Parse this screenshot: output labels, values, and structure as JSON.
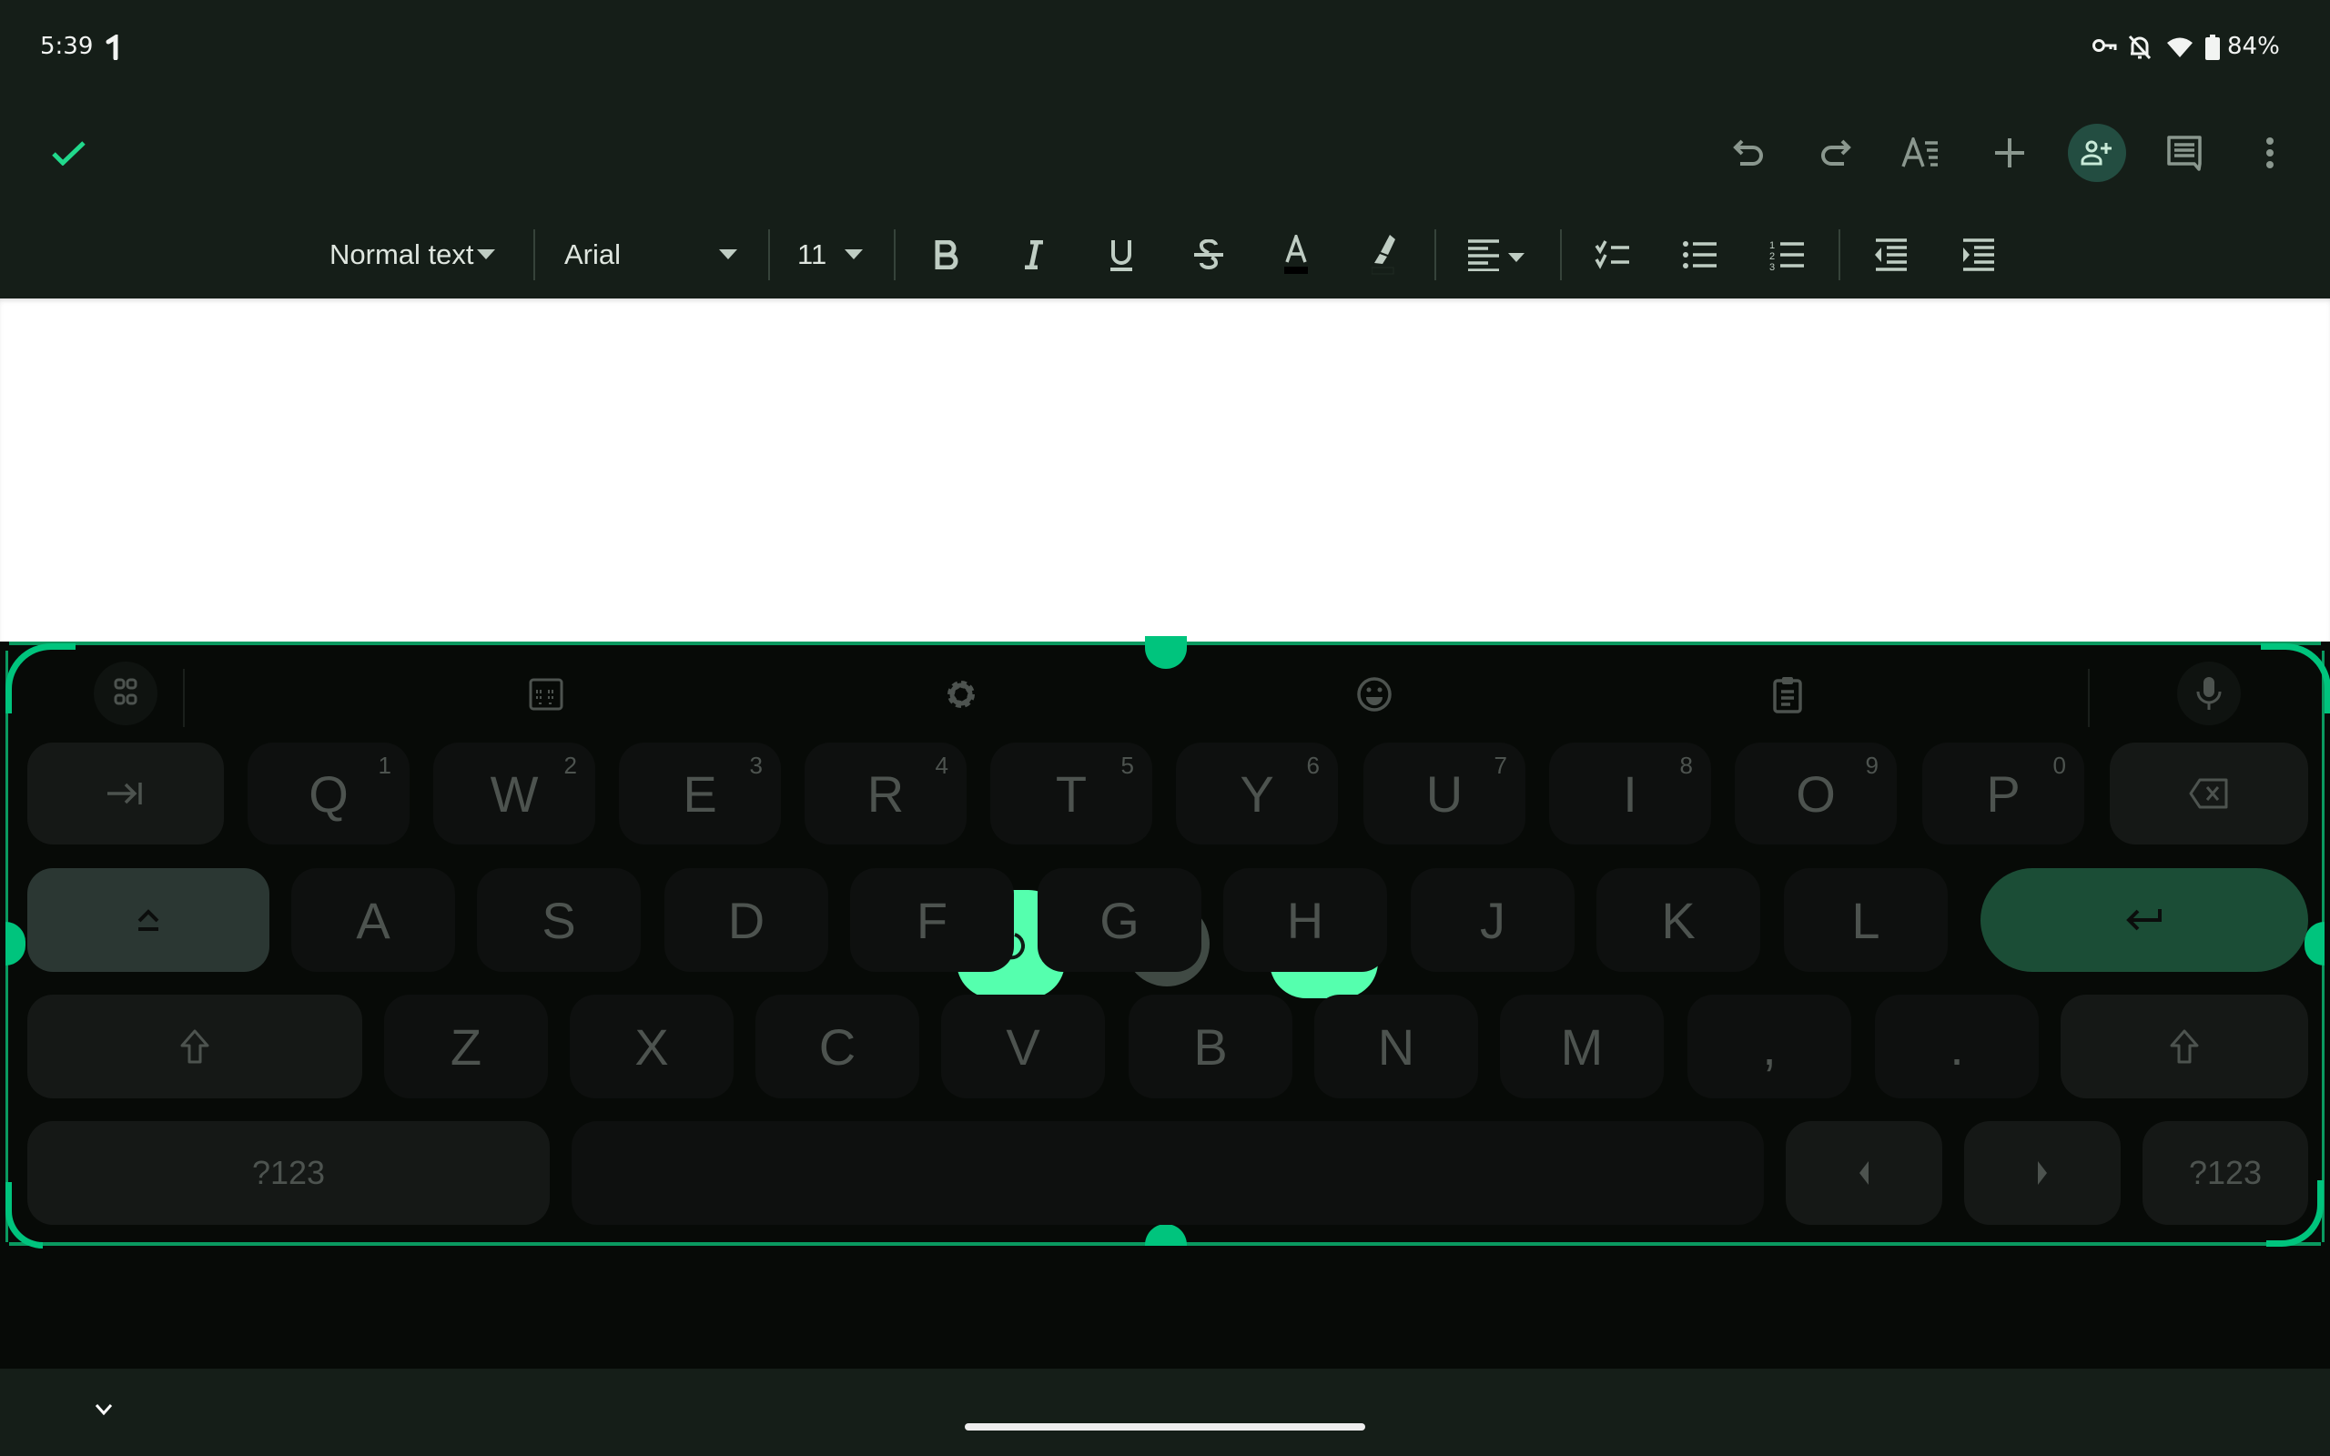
{
  "status_bar": {
    "time": "5:39",
    "battery_percent": "84%",
    "icons": [
      "notification-icon",
      "vpn-key-icon",
      "bell-off-icon",
      "wifi-icon",
      "battery-icon"
    ]
  },
  "app_bar": {
    "done_icon": "check-icon",
    "actions": [
      "undo",
      "redo",
      "text-format",
      "insert",
      "share",
      "comments",
      "more-options"
    ]
  },
  "format_toolbar": {
    "style_select": "Normal text",
    "font_select": "Arial",
    "size_select": "11",
    "buttons": [
      "bold",
      "italic",
      "underline",
      "strikethrough",
      "text-color",
      "highlight",
      "align",
      "checklist",
      "bulleted-list",
      "numbered-list",
      "decrease-indent",
      "increase-indent"
    ]
  },
  "keyboard": {
    "accent_color": "#00c47d",
    "toolbar": [
      "apps",
      "keyboard-mode",
      "settings",
      "emoji",
      "clipboard",
      "voice-input"
    ],
    "row1": [
      {
        "label": "Q",
        "hint": "1"
      },
      {
        "label": "W",
        "hint": "2"
      },
      {
        "label": "E",
        "hint": "3"
      },
      {
        "label": "R",
        "hint": "4"
      },
      {
        "label": "T",
        "hint": "5"
      },
      {
        "label": "Y",
        "hint": "6"
      },
      {
        "label": "U",
        "hint": "7"
      },
      {
        "label": "I",
        "hint": "8"
      },
      {
        "label": "O",
        "hint": "9"
      },
      {
        "label": "P",
        "hint": "0"
      }
    ],
    "row2": [
      "A",
      "S",
      "D",
      "F",
      "G",
      "H",
      "J",
      "K",
      "L"
    ],
    "row3": [
      "Z",
      "X",
      "C",
      "V",
      "B",
      "N",
      "M",
      ",",
      "."
    ],
    "symbols_left": "?123",
    "symbols_right": "?123",
    "resize_controls": {
      "reset": "reset-icon",
      "move": "move-icon",
      "confirm": "check-icon"
    }
  }
}
